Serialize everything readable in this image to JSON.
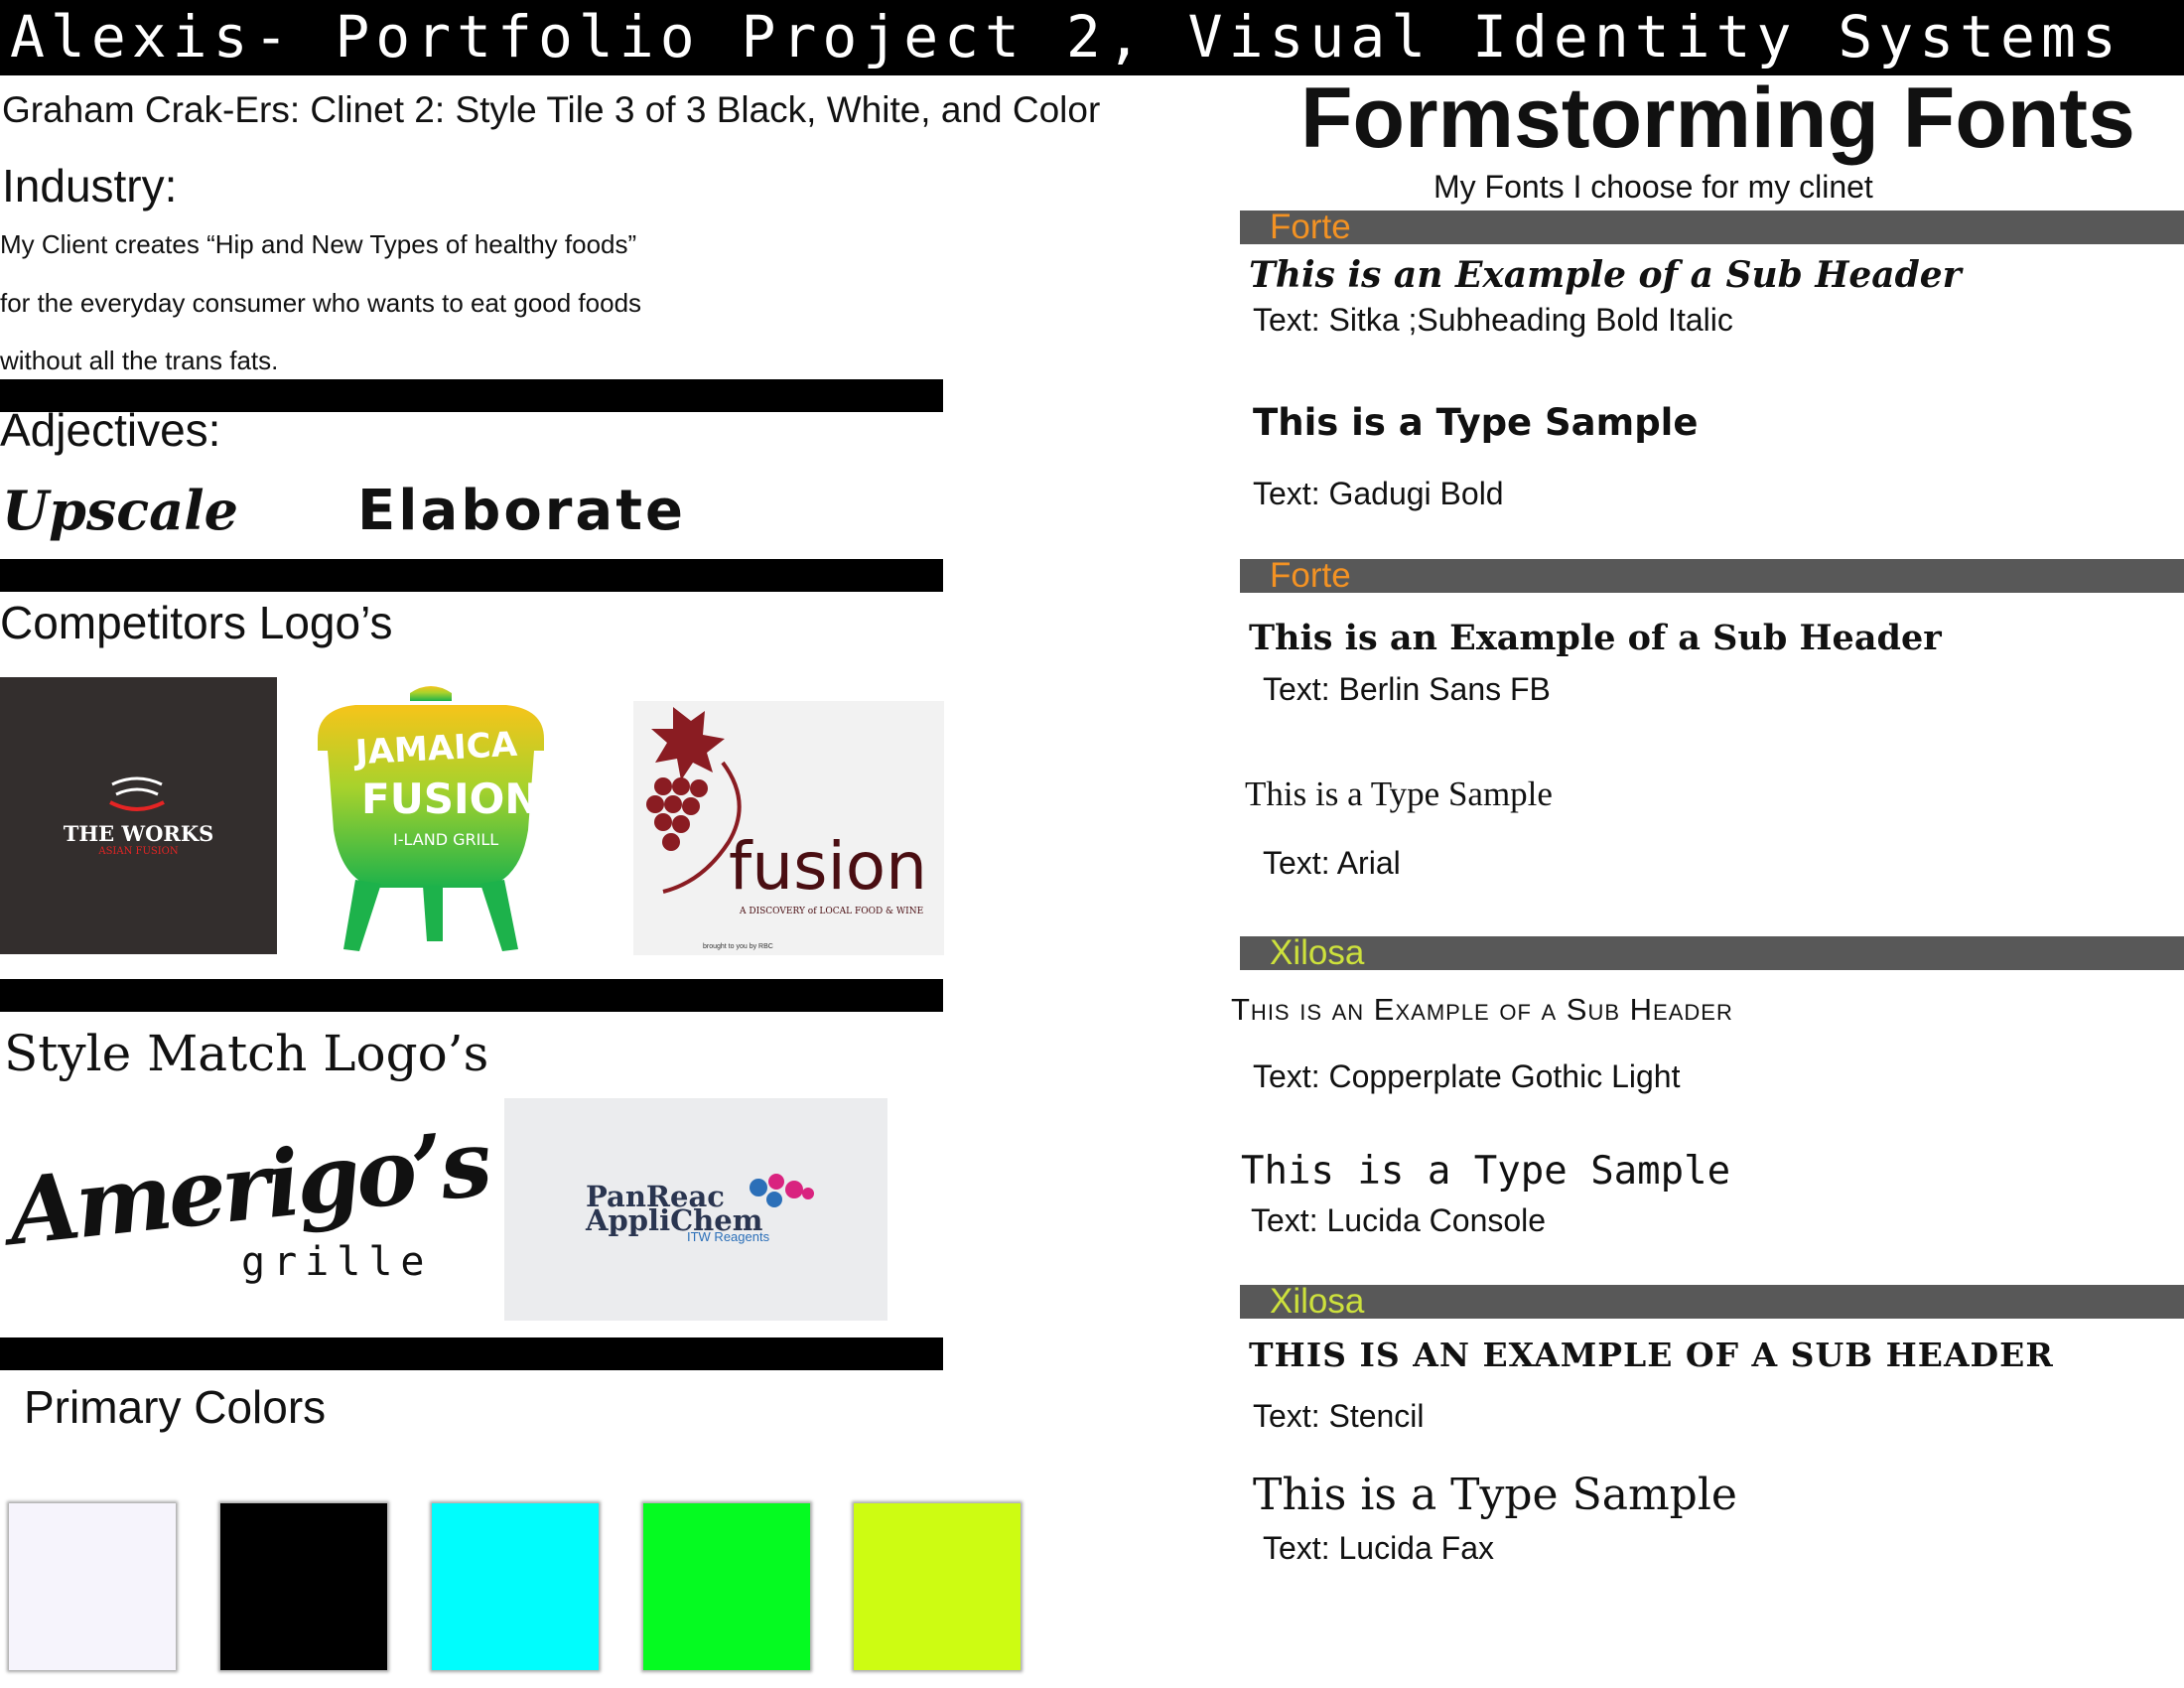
{
  "header": {
    "title": "Alexis- Portfolio Project 2, Visual Identity Systems"
  },
  "left": {
    "subtitle": "Graham Crak-Ers: Clinet 2: Style Tile 3 of 3 Black, White, and Color",
    "industry_heading": "Industry:",
    "industry_lines": [
      "My Client creates “Hip and New Types of healthy foods”",
      "for the everyday consumer who wants to eat good foods",
      "without all the trans fats."
    ],
    "adjectives_heading": "Adjectives:",
    "adjectives": [
      "Upscale",
      "Elaborate"
    ],
    "competitors_heading": "Competitors Logo’s",
    "competitor_logos": {
      "works": {
        "name": "THE WORKS",
        "tagline": "ASIAN FUSION"
      },
      "jamaica": {
        "line1": "JAMAICA",
        "line2": "FUSION",
        "line3": "I-LAND GRILL"
      },
      "fusion": {
        "name": "fusion",
        "tagline": "A DISCOVERY of LOCAL FOOD & WINE",
        "credit": "brought to you by RBC"
      }
    },
    "style_match_heading": "Style Match Logo’s",
    "style_logos": {
      "amerigos": {
        "name": "Amerigo’s",
        "sub": "grille"
      },
      "panreac": {
        "line1": "PanReac",
        "line2": "AppliChem",
        "line3": "ITW Reagents"
      }
    },
    "colors_heading": "Primary Colors",
    "primary_colors": [
      "#f6f4fc",
      "#000000",
      "#00fdfd",
      "#05fb21",
      "#cdfc12"
    ]
  },
  "right": {
    "heading": "Formstorming Fonts",
    "subheading": "My Fonts I choose for my clinet",
    "sections": [
      {
        "label": "Forte",
        "label_color": "#f39223",
        "sub_header": "This is an Example of a Sub Header",
        "sub_header_note": "Text: Sitka ;Subheading Bold Italic",
        "sample": "This is a Type Sample",
        "sample_note": "Text: Gadugi Bold"
      },
      {
        "label": "Forte",
        "label_color": "#f39223",
        "sub_header": "This is an Example of a Sub Header",
        "sub_header_note": "Text: Berlin Sans FB",
        "sample": "This is a Type Sample",
        "sample_note": "Text: Arial"
      },
      {
        "label": "Xilosa",
        "label_color": "#cde13c",
        "sub_header": "This is an Example of a Sub Header",
        "sub_header_note": "Text: Copperplate Gothic Light",
        "sample": "This is a Type Sample",
        "sample_note": "Text: Lucida Console"
      },
      {
        "label": "Xilosa",
        "label_color": "#cde13c",
        "sub_header": "THIS IS AN EXAMPLE OF A SUB HEADER",
        "sub_header_note": "Text: Stencil",
        "sample": "This is a Type Sample",
        "sample_note": "Text: Lucida Fax"
      }
    ]
  }
}
